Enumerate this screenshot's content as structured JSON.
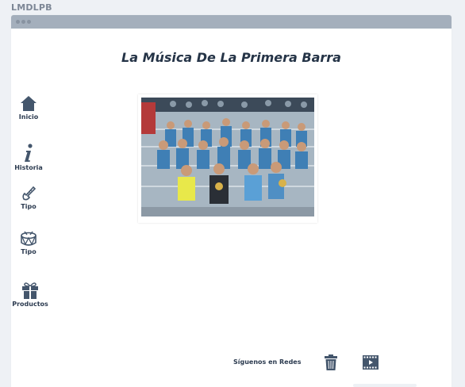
{
  "app": {
    "title": "LMDLPB"
  },
  "page": {
    "title": "La Música De La Primera Barra"
  },
  "sidebar": {
    "items": [
      {
        "label": "Inicio",
        "icon": "home-icon"
      },
      {
        "label": "Historia",
        "icon": "info-icon"
      },
      {
        "label": "Tipo",
        "icon": "trumpet-icon"
      },
      {
        "label": "Tipo",
        "icon": "drum-icon"
      },
      {
        "label": "Productos",
        "icon": "gift-icon"
      }
    ]
  },
  "photo": {
    "subject": "band-photo"
  },
  "footer": {
    "follow_label": "Síguenos en Redes",
    "social": [
      {
        "icon": "trash-icon"
      },
      {
        "icon": "film-icon"
      }
    ]
  },
  "colors": {
    "titlebar": "#a4afbc",
    "text_dark": "#253447",
    "background": "#eef1f5"
  }
}
